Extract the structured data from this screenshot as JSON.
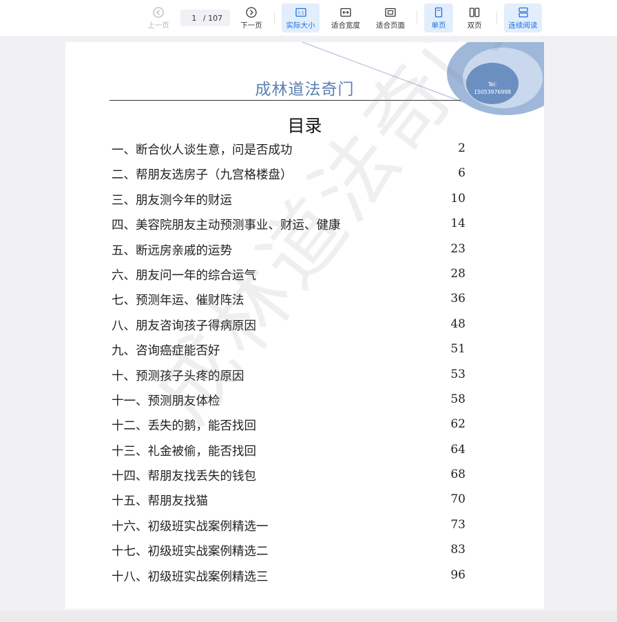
{
  "toolbar": {
    "prev_label": "上一页",
    "page_current": "1",
    "page_total": "/ 107",
    "next_label": "下一页",
    "actual_size_label": "实际大小",
    "fit_width_label": "适合宽度",
    "fit_page_label": "适合页面",
    "single_page_label": "单页",
    "two_page_label": "双页",
    "continuous_label": "连续阅读",
    "accent_color": "#1a6fe0"
  },
  "document": {
    "header": "成林道法奇门",
    "badge_line1": "Tel:",
    "badge_line2": "15053976998",
    "toc_title": "目录",
    "watermark": "成林道法奇门",
    "toc": [
      {
        "label": "一、断合伙人谈生意，问是否成功",
        "page": "2"
      },
      {
        "label": "二、帮朋友选房子（九宫格楼盘）",
        "page": "6"
      },
      {
        "label": "三、朋友测今年的财运",
        "page": "10"
      },
      {
        "label": "四、美容院朋友主动预测事业、财运、健康",
        "page": "14"
      },
      {
        "label": "五、断远房亲戚的运势",
        "page": "23"
      },
      {
        "label": "六、朋友问一年的综合运气",
        "page": "28"
      },
      {
        "label": "七、预测年运、催财阵法",
        "page": "36"
      },
      {
        "label": "八、朋友咨询孩子得病原因",
        "page": "48"
      },
      {
        "label": "九、咨询癌症能否好",
        "page": "51"
      },
      {
        "label": "十、预测孩子头疼的原因",
        "page": "53"
      },
      {
        "label": "十一、预测朋友体检",
        "page": "58"
      },
      {
        "label": "十二、丢失的鹅，能否找回",
        "page": "62"
      },
      {
        "label": "十三、礼金被偷，能否找回",
        "page": "64"
      },
      {
        "label": "十四、帮朋友找丢失的钱包",
        "page": "68"
      },
      {
        "label": "十五、帮朋友找猫",
        "page": "70"
      },
      {
        "label": "十六、初级班实战案例精选一",
        "page": "73"
      },
      {
        "label": "十七、初级班实战案例精选二",
        "page": "83"
      },
      {
        "label": "十八、初级班实战案例精选三",
        "page": "96"
      }
    ]
  }
}
